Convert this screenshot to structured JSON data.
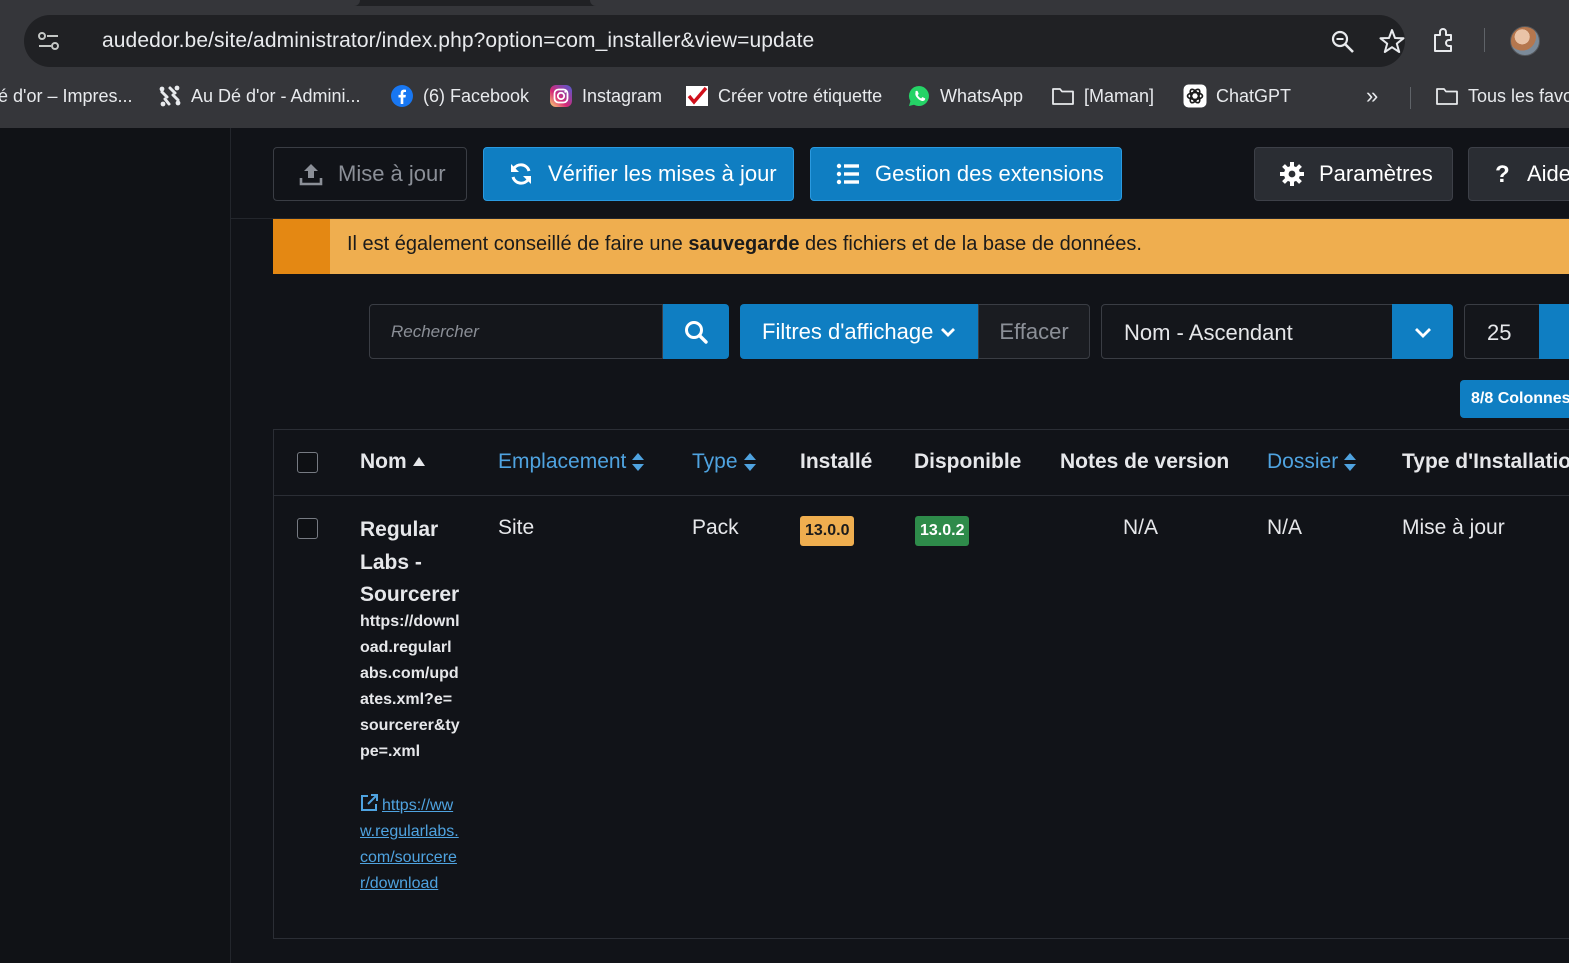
{
  "browser": {
    "url": "audedor.be/site/administrator/index.php?option=com_installer&view=update",
    "bookmarks": [
      {
        "label": "é d'or – Impres...",
        "icon": "none"
      },
      {
        "label": "Au Dé d'or - Admini...",
        "icon": "joomla-icon"
      },
      {
        "label": "(6) Facebook",
        "icon": "facebook-icon"
      },
      {
        "label": "Instagram",
        "icon": "instagram-icon"
      },
      {
        "label": "Créer votre étiquette",
        "icon": "label-icon"
      },
      {
        "label": "WhatsApp",
        "icon": "whatsapp-icon"
      },
      {
        "label": "[Maman]",
        "icon": "folder-icon"
      },
      {
        "label": "ChatGPT",
        "icon": "chatgpt-icon"
      }
    ],
    "overflow_label": "»",
    "all_bookmarks_label": "Tous les favoris"
  },
  "toolbar": {
    "update_label": "Mise à jour",
    "check_label": "Vérifier les mises à jour",
    "manage_label": "Gestion des extensions",
    "params_label": "Paramètres",
    "help_label": "Aide"
  },
  "alert": {
    "text_before": "Il est également conseillé de faire une ",
    "text_bold": "sauvegarde",
    "text_after": " des fichiers et de la base de données."
  },
  "filters": {
    "search_placeholder": "Rechercher",
    "filters_label": "Filtres d'affichage",
    "clear_label": "Effacer",
    "sort_value": "Nom - Ascendant",
    "limit_value": "25",
    "columns_label": "8/8 Colonnes"
  },
  "table": {
    "headers": {
      "name": "Nom",
      "location": "Emplacement",
      "type": "Type",
      "installed": "Installé",
      "available": "Disponible",
      "notes": "Notes de version",
      "folder": "Dossier",
      "install_type": "Type d'Installation"
    },
    "rows": [
      {
        "name": "Regular Labs - Sourcerer",
        "update_url": "https://download.regularlabs.com/updates.xml?e=sourcerer&type=.xml",
        "info_url": "https://www.regularlabs.com/sourcerer/download",
        "location": "Site",
        "type": "Pack",
        "installed": "13.0.0",
        "available": "13.0.2",
        "notes": "N/A",
        "folder": "N/A",
        "install_type": "Mise à jour"
      }
    ]
  },
  "colors": {
    "primary": "#0f7ec2",
    "warning": "#efae4f",
    "success": "#2e8b4a",
    "link": "#4fa3e0"
  }
}
